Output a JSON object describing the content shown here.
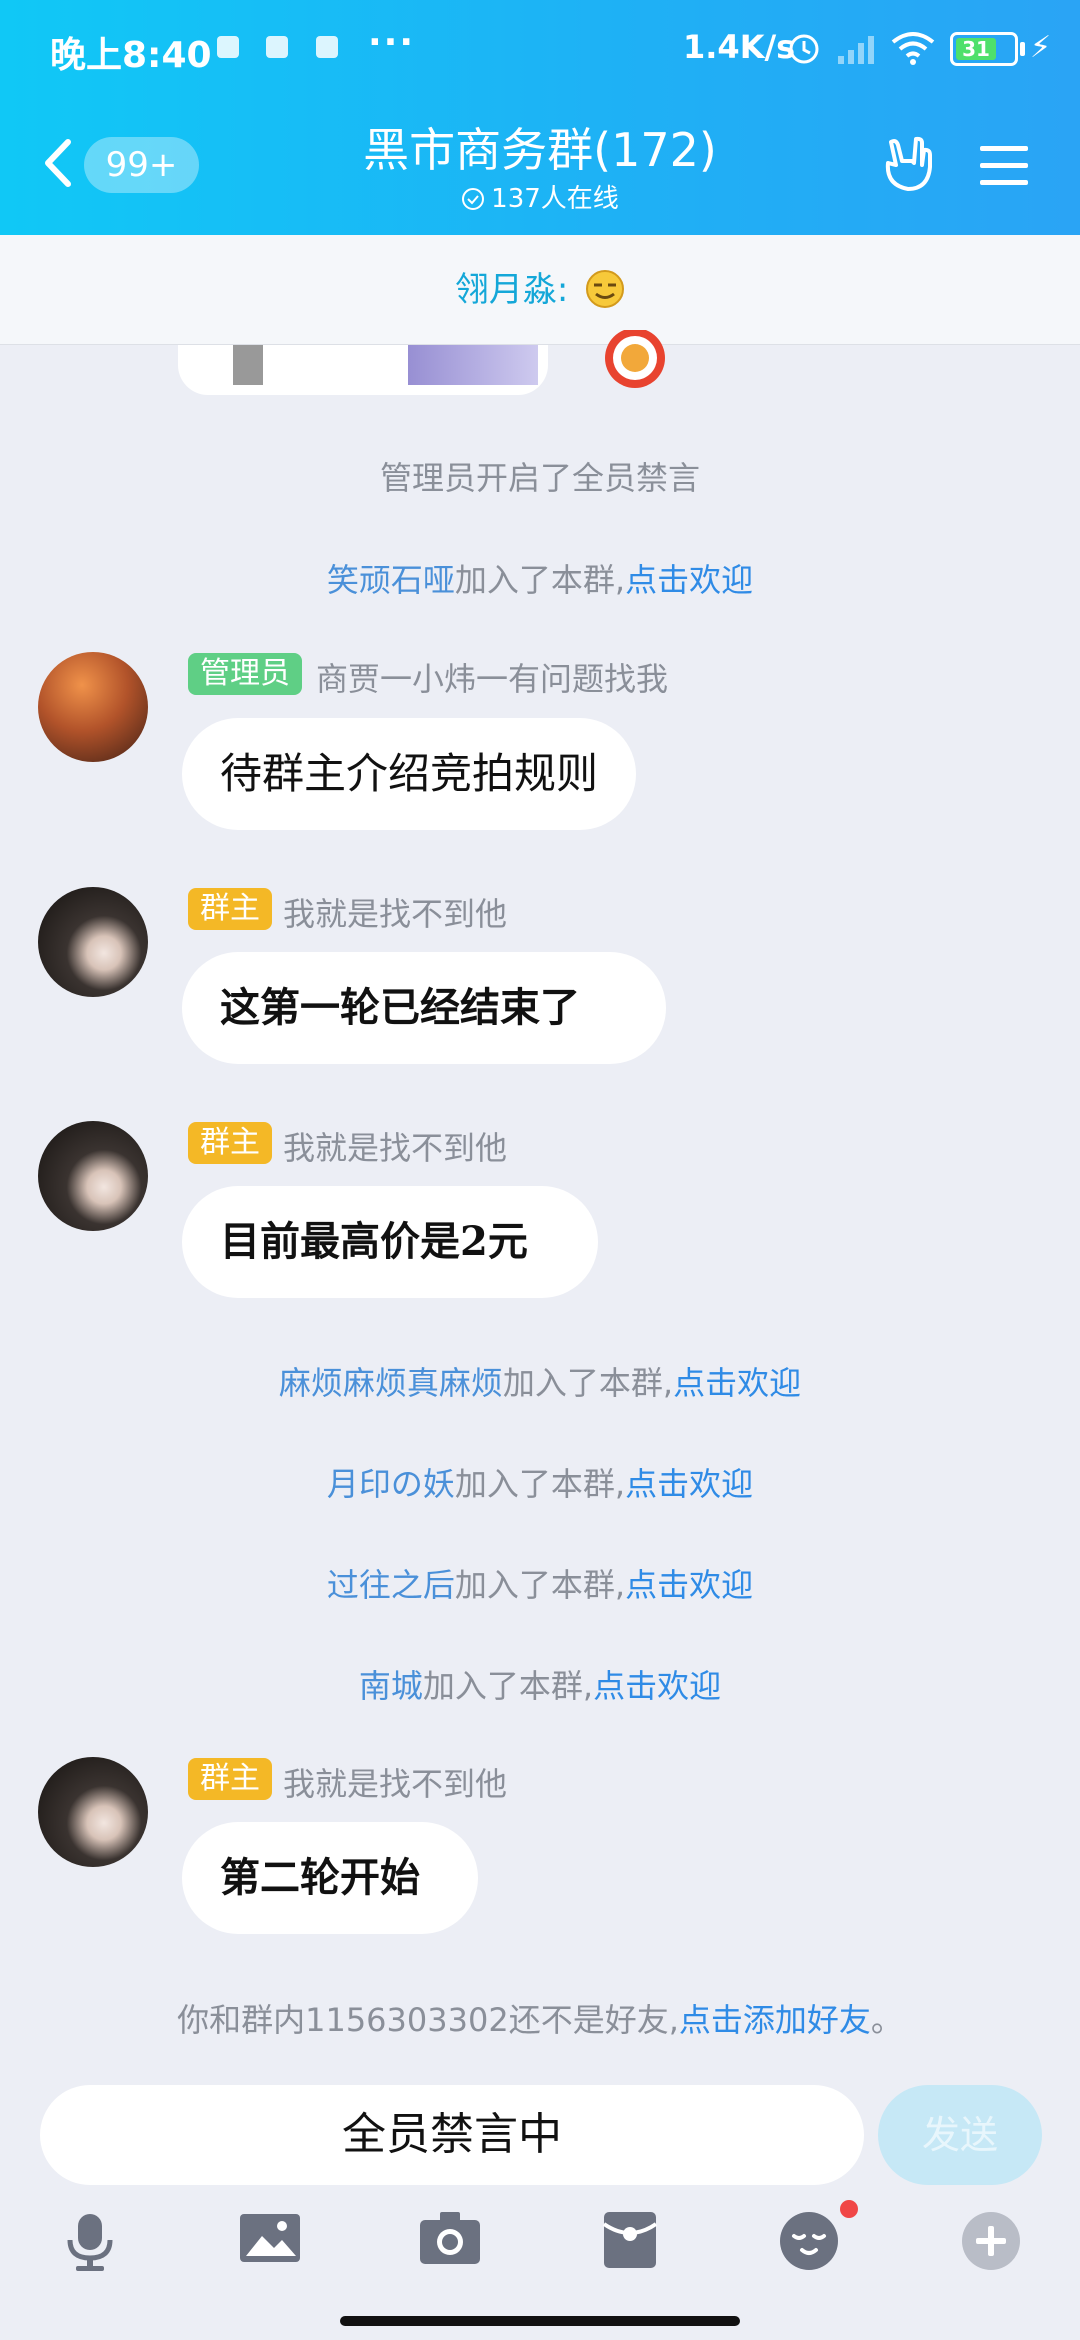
{
  "status_bar": {
    "time": "晚上8:40",
    "dots": "···",
    "net_speed": "1.4K/s",
    "battery": "31"
  },
  "header": {
    "back_badge": "99+",
    "title": "黑市商务群(172)",
    "online": "137人在线"
  },
  "pinned": {
    "text": "翎月淼:"
  },
  "messages": {
    "sys1": "管理员开启了全员禁言",
    "join1": {
      "name": "笑顽石哑",
      "text": "加入了本群,",
      "link": "点击欢迎"
    },
    "m1": {
      "tag": "管理员",
      "nick": "商贾一小炜一有问题找我",
      "text": "待群主介绍竞拍规则"
    },
    "m2": {
      "tag": "群主",
      "nick": "我就是找不到他",
      "text": "这第一轮已经结束了"
    },
    "m3": {
      "tag": "群主",
      "nick": "我就是找不到他",
      "text": "目前最高价是2元"
    },
    "join2": {
      "name": "麻烦麻烦真麻烦",
      "text": "加入了本群,",
      "link": "点击欢迎"
    },
    "join3": {
      "name": "月印の妖",
      "text": "加入了本群,",
      "link": "点击欢迎"
    },
    "join4": {
      "name": "过往之后",
      "text": "加入了本群,",
      "link": "点击欢迎"
    },
    "join5": {
      "name": "南城",
      "text": "加入了本群,",
      "link": "点击欢迎"
    },
    "m4": {
      "tag": "群主",
      "nick": "我就是找不到他",
      "text": "第二轮开始"
    },
    "friend": {
      "text": "你和群内1156303302还不是好友,",
      "link": "点击添加好友",
      "end": "。"
    }
  },
  "input_bar": {
    "placeholder": "全员禁言中",
    "send_label": "发送"
  },
  "toolbar_icons": [
    "mic-icon",
    "image-icon",
    "camera-icon",
    "red-packet-icon",
    "emoji-icon",
    "plus-icon"
  ],
  "colors": {
    "header": "#1fb0f5",
    "link": "#2f8be6",
    "admin_tag": "#5fcf85",
    "owner_tag": "#f4b826"
  }
}
